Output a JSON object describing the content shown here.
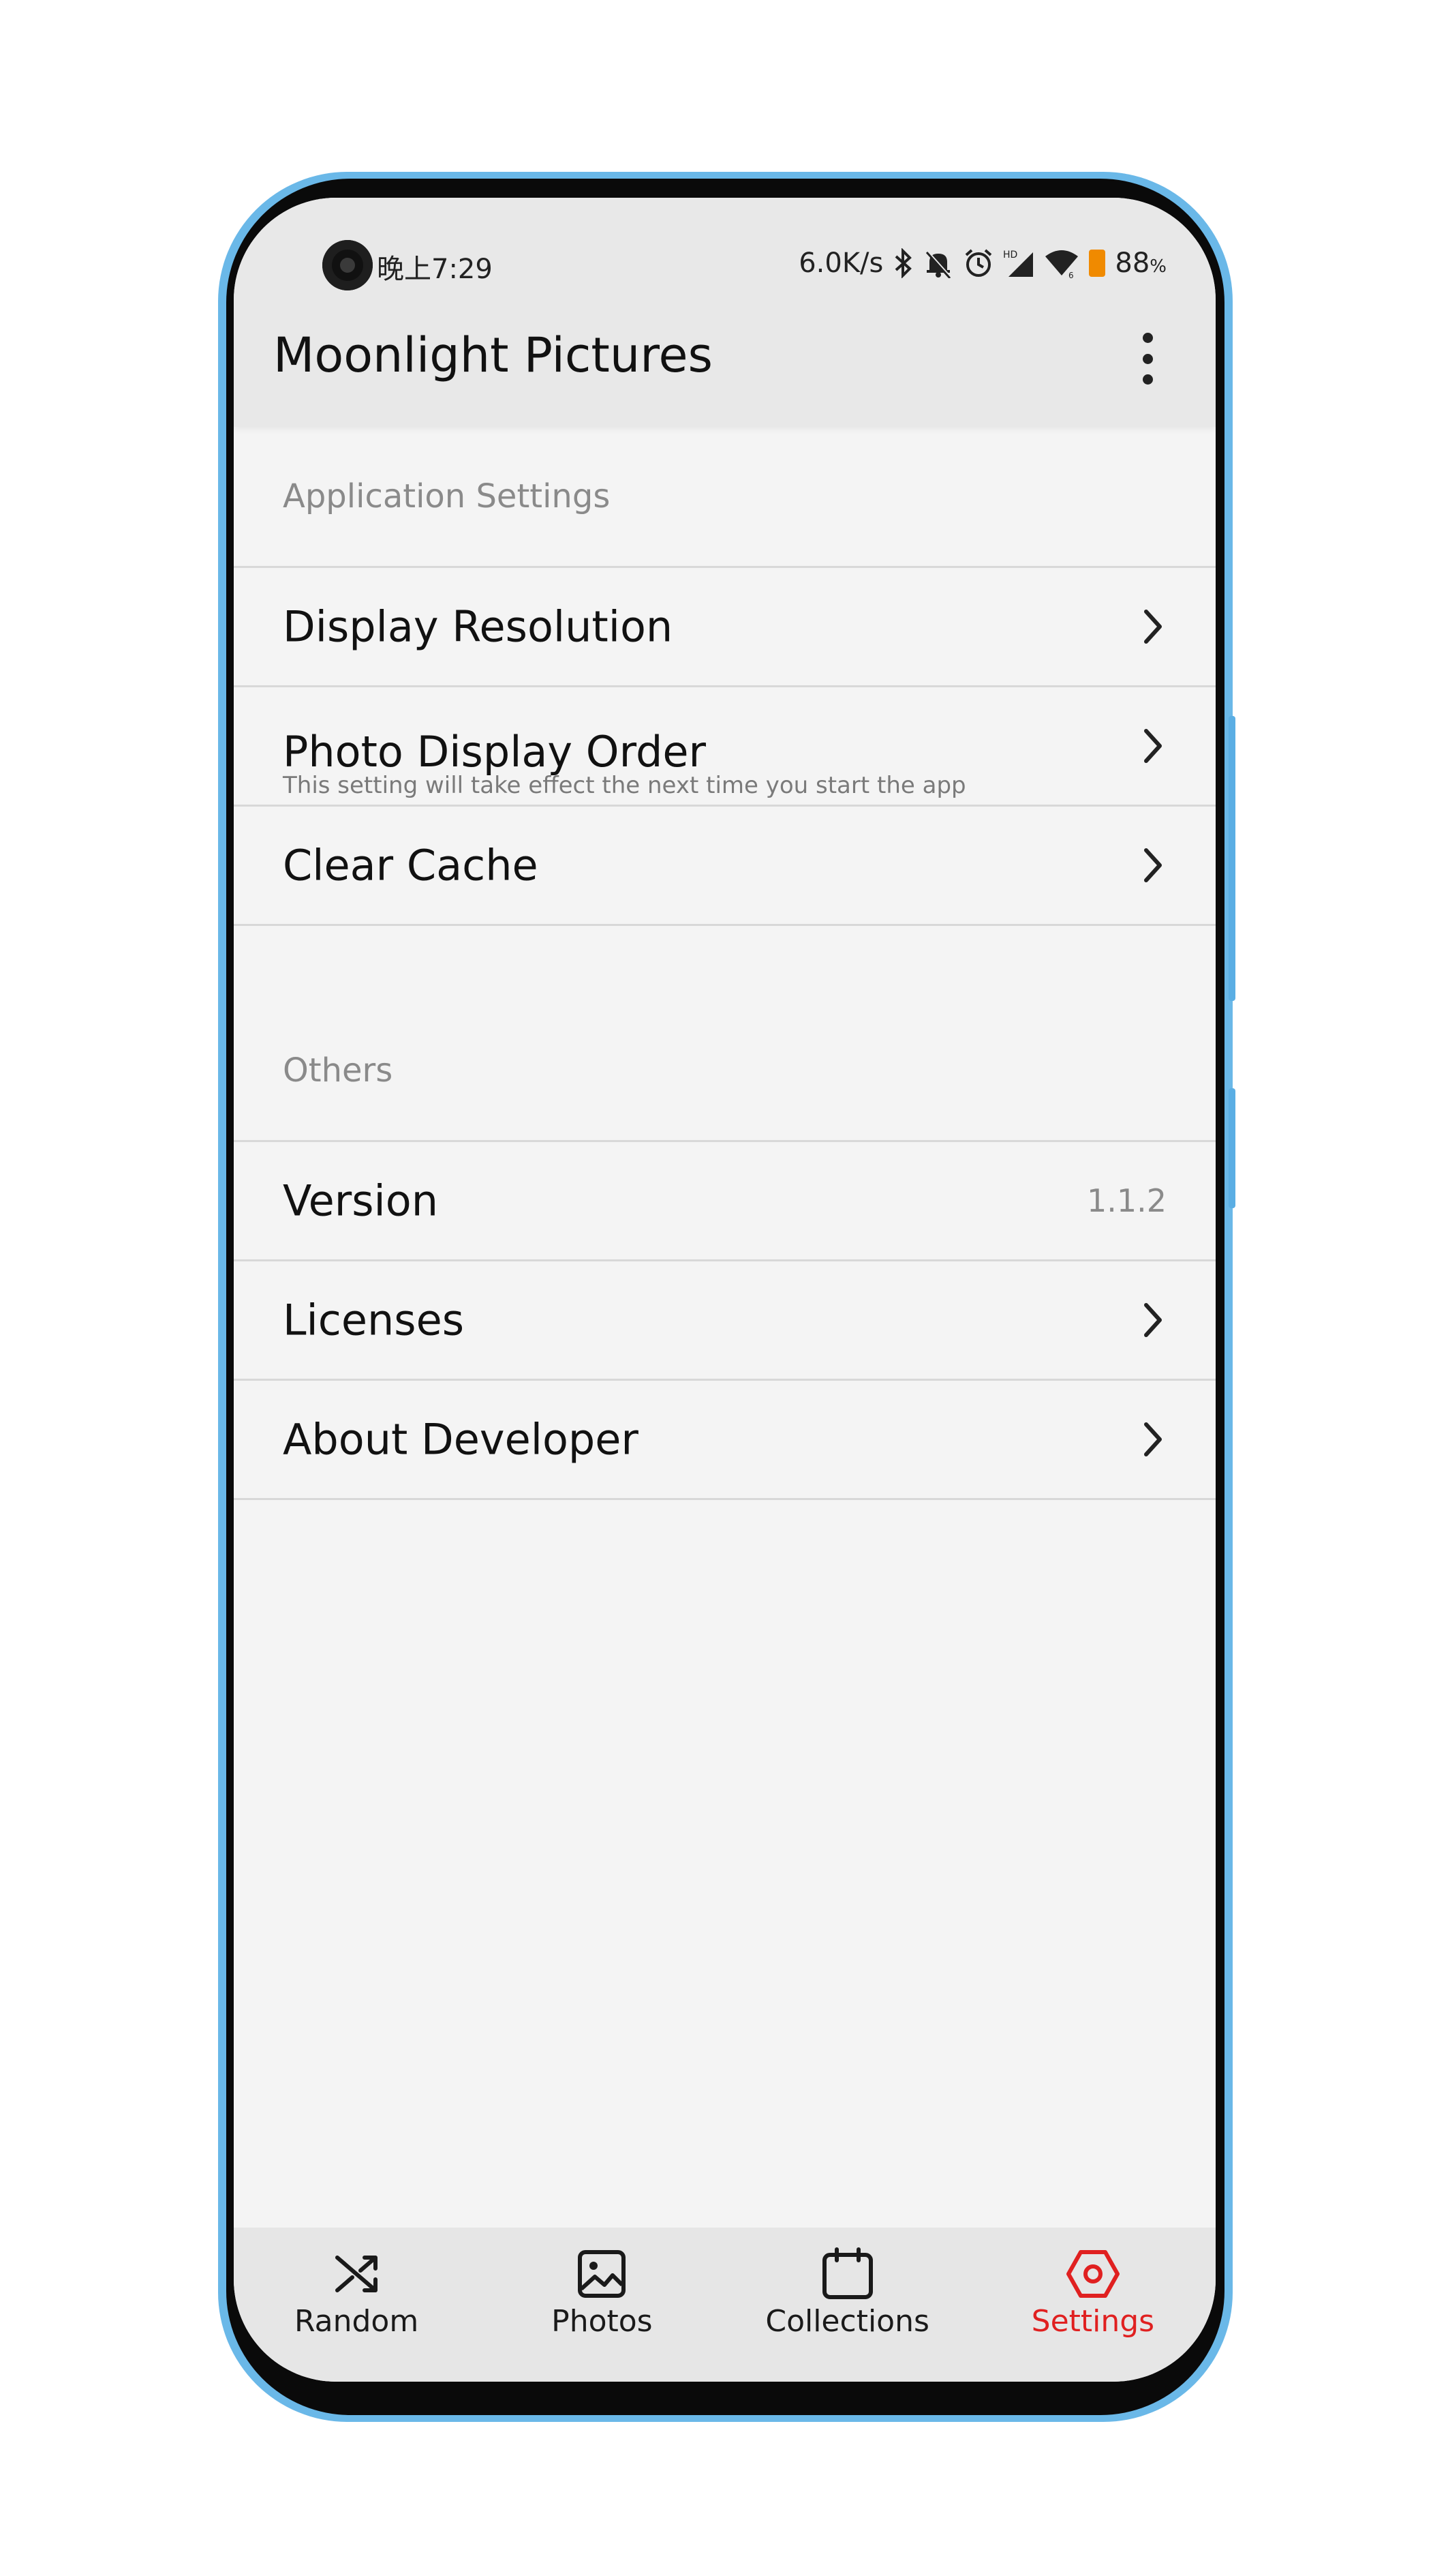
{
  "status_bar": {
    "time": "晚上7:29",
    "network_speed": "6.0K/s",
    "battery_percent": "88",
    "battery_unit": "%",
    "icons": [
      "bluetooth-icon",
      "mute-icon",
      "alarm-icon",
      "hd-signal-icon",
      "wifi-icon",
      "battery-icon"
    ]
  },
  "app_bar": {
    "title": "Moonlight Pictures",
    "menu_icon": "more-vertical-icon"
  },
  "sections": {
    "application": {
      "header": "Application Settings",
      "items": [
        {
          "label": "Display Resolution",
          "icon": "chevron-right-icon"
        },
        {
          "label": "Photo Display Order",
          "subtitle": "This setting will take effect the next time you start the app",
          "icon": "chevron-right-icon"
        },
        {
          "label": "Clear Cache",
          "icon": "chevron-right-icon"
        }
      ]
    },
    "others": {
      "header": "Others",
      "items": [
        {
          "label": "Version",
          "value": "1.1.2"
        },
        {
          "label": "Licenses",
          "icon": "chevron-right-icon"
        },
        {
          "label": "About Developer",
          "icon": "chevron-right-icon"
        }
      ]
    }
  },
  "bottom_nav": {
    "active_color": "#e02020",
    "items": [
      {
        "label": "Random",
        "icon": "shuffle-icon",
        "active": false
      },
      {
        "label": "Photos",
        "icon": "image-icon",
        "active": false
      },
      {
        "label": "Collections",
        "icon": "calendar-icon",
        "active": false
      },
      {
        "label": "Settings",
        "icon": "settings-hexagon-icon",
        "active": true
      }
    ]
  }
}
